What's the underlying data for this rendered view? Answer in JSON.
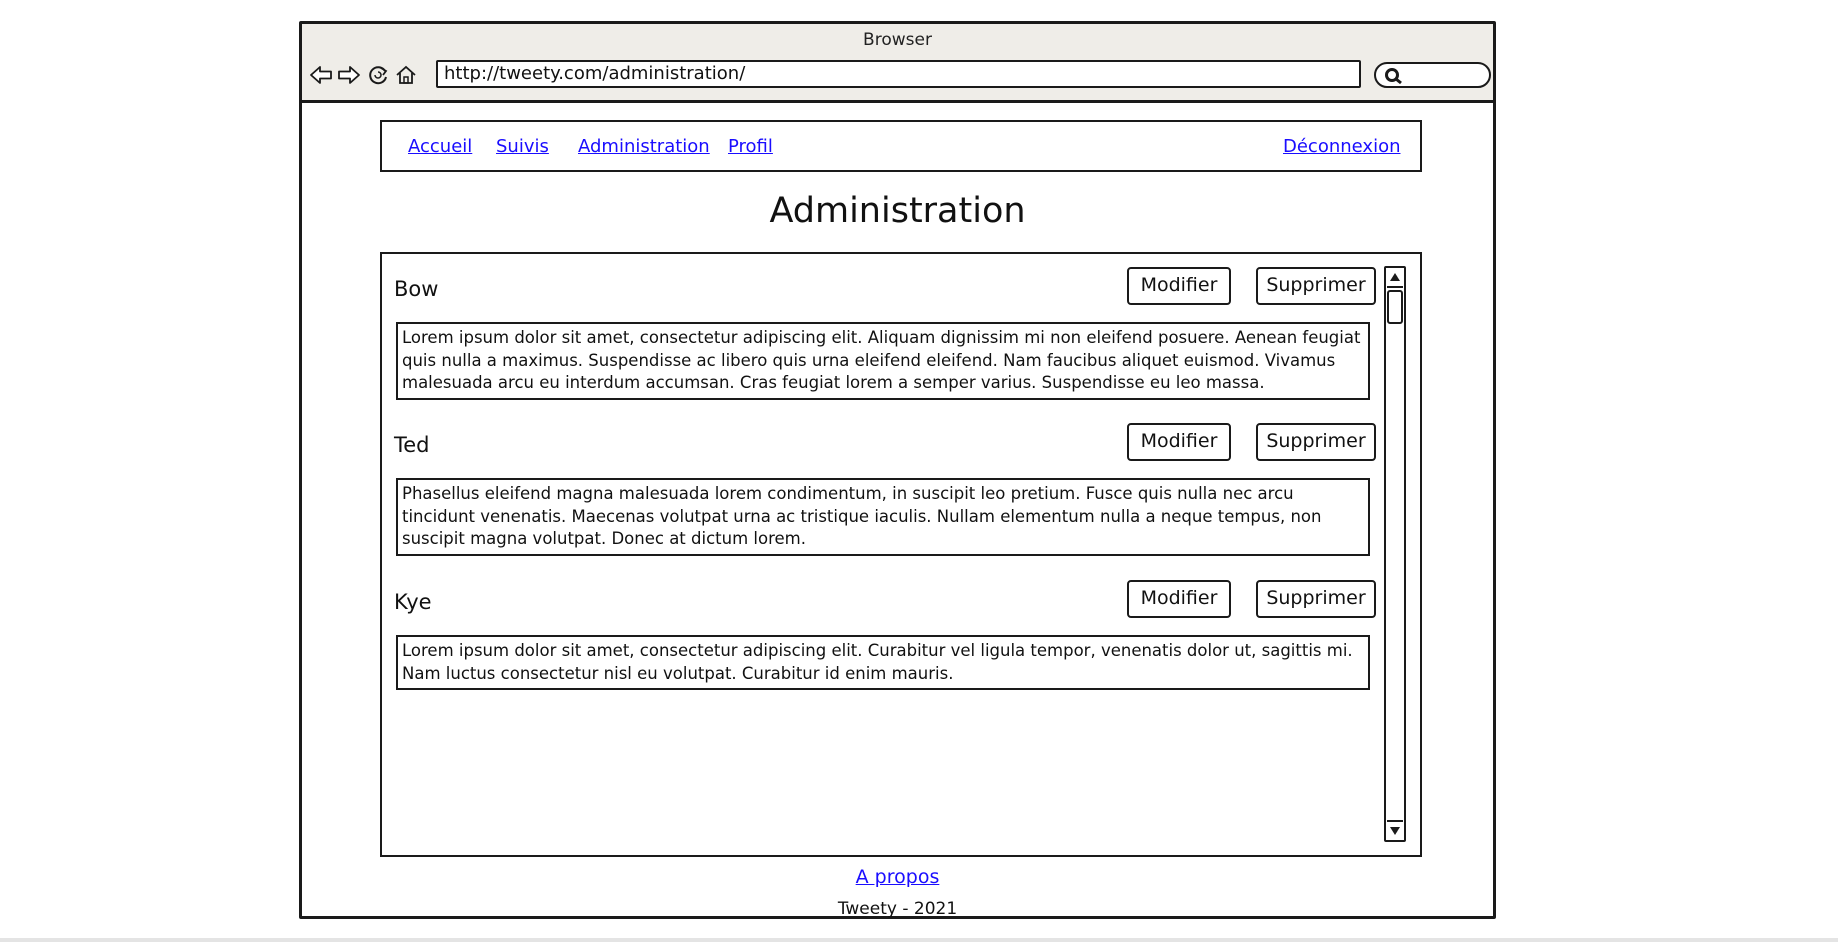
{
  "browser": {
    "title": "Browser",
    "url": "http://tweety.com/administration/"
  },
  "nav": {
    "links": [
      "Accueil",
      "Suivis",
      "Administration",
      "Profil"
    ],
    "logout": "Déconnexion"
  },
  "page": {
    "title": "Administration"
  },
  "entries": [
    {
      "name": "Bow",
      "text": "Lorem ipsum dolor sit amet, consectetur adipiscing elit. Aliquam dignissim mi non eleifend posuere. Aenean feugiat quis nulla a maximus. Suspendisse ac libero quis urna eleifend eleifend. Nam faucibus aliquet euismod. Vivamus malesuada arcu eu interdum accumsan. Cras feugiat lorem a semper varius. Suspendisse eu leo massa.",
      "modify_label": "Modifier",
      "delete_label": "Supprimer"
    },
    {
      "name": "Ted",
      "text": "Phasellus eleifend magna malesuada lorem condimentum, in suscipit leo pretium. Fusce quis nulla nec arcu tincidunt venenatis. Maecenas volutpat urna ac tristique iaculis. Nullam elementum nulla a neque tempus, non suscipit magna volutpat. Donec at dictum lorem.",
      "modify_label": "Modifier",
      "delete_label": "Supprimer"
    },
    {
      "name": "Kye",
      "text": "Lorem ipsum dolor sit amet, consectetur adipiscing elit. Curabitur vel ligula tempor, venenatis dolor ut, sagittis mi. Nam luctus consectetur nisl eu volutpat. Curabitur id enim mauris.",
      "modify_label": "Modifier",
      "delete_label": "Supprimer"
    }
  ],
  "footer": {
    "about": "A propos",
    "copyright": "Tweety - 2021"
  },
  "icons": {
    "back": "arrow-left-icon",
    "forward": "arrow-right-icon",
    "reload": "reload-icon",
    "home": "home-icon",
    "search": "search-icon",
    "scroll_up": "triangle-up-icon",
    "scroll_down": "triangle-down-icon"
  }
}
